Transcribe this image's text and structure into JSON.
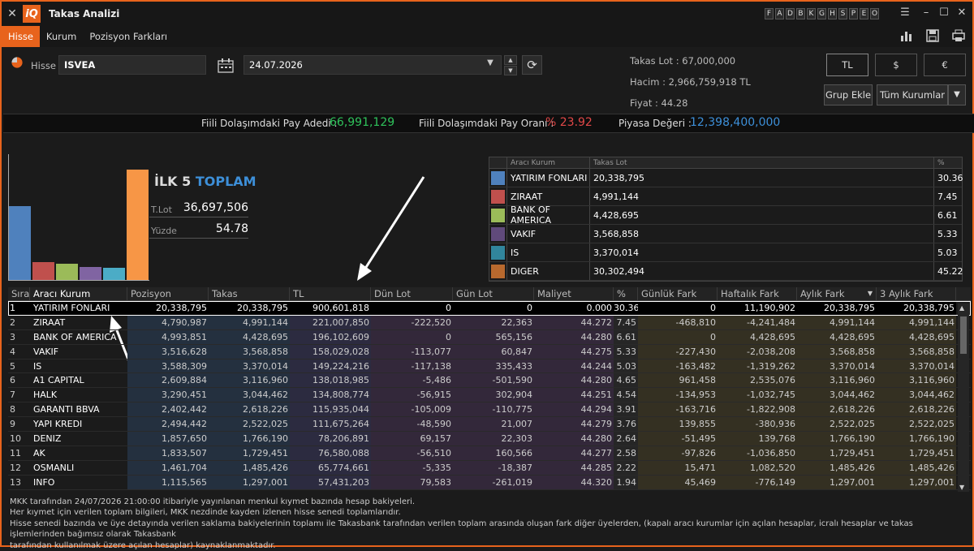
{
  "window": {
    "title": "Takas Analizi",
    "letters": [
      "F",
      "A",
      "D",
      "B",
      "K",
      "G",
      "H",
      "S",
      "P",
      "E",
      "O"
    ]
  },
  "menu": {
    "items": [
      "Hisse",
      "Kurum",
      "Pozisyon Farkları"
    ]
  },
  "form": {
    "hisse_label": "Hisse",
    "hisse_value": "ISVEA",
    "date_value": "24.07.2026",
    "info_takas_lot": "Takas Lot : 67,000,000",
    "info_hacim": "Hacim : 2,966,759,918 TL",
    "info_fiyat": "Fiyat : 44.28",
    "currency": [
      "TL",
      "$",
      "€"
    ],
    "grup_ekle": "Grup Ekle",
    "tum_kurumlar": "Tüm Kurumlar"
  },
  "stats": {
    "pay_adedi_label": "Fiili Dolaşımdaki Pay Adedi :",
    "pay_adedi_value": "66,991,129",
    "pay_orani_label": "Fiili Dolaşımdaki Pay Oranı :",
    "pay_orani_value": "% 23.92",
    "piyasa_label": "Piyasa Değeri :",
    "piyasa_value": "12,398,400,000"
  },
  "summary": {
    "title_a": "İLK 5",
    "title_b": "TOPLAM",
    "tlot_label": "T.Lot",
    "tlot_value": "36,697,506",
    "yuzde_label": "Yüzde",
    "yuzde_value": "54.78"
  },
  "chart_data": {
    "type": "bar",
    "categories": [
      "YATIRIM FONLARI",
      "ZIRAAT",
      "BANK OF AMERICA",
      "VAKIF",
      "IS",
      "DIGER"
    ],
    "values": [
      30.36,
      7.45,
      6.61,
      5.33,
      5.03,
      45.22
    ],
    "colors": [
      "#4f81bd",
      "#c0504d",
      "#9bbb59",
      "#8064a2",
      "#4bacc6",
      "#f79646"
    ],
    "ylim": [
      0,
      50
    ]
  },
  "top_table": {
    "headers": [
      "Aracı Kurum",
      "Takas Lot",
      "%"
    ],
    "rows": [
      {
        "name": "YATIRIM FONLARI",
        "lot": "20,338,795",
        "pct": "30.36",
        "color": "#4f81bd"
      },
      {
        "name": "ZIRAAT",
        "lot": "4,991,144",
        "pct": "7.45",
        "color": "#c0504d"
      },
      {
        "name": "BANK OF AMERICA",
        "lot": "4,428,695",
        "pct": "6.61",
        "color": "#9bbb59"
      },
      {
        "name": "VAKIF",
        "lot": "3,568,858",
        "pct": "5.33",
        "color": "#604a7b"
      },
      {
        "name": "IS",
        "lot": "3,370,014",
        "pct": "5.03",
        "color": "#31859c"
      },
      {
        "name": "DIGER",
        "lot": "30,302,494",
        "pct": "45.22",
        "color": "#b8692e"
      }
    ]
  },
  "grid": {
    "headers": [
      "Sıra",
      "Aracı Kurum",
      "Pozisyon",
      "Takas",
      "TL",
      "Dün Lot",
      "Gün Lot",
      "Maliyet",
      "%",
      "Günlük Fark",
      "Haftalık Fark",
      "Aylık Fark",
      "3 Aylık Fark"
    ],
    "rows": [
      [
        "1",
        "YATIRIM FONLARI",
        "20,338,795",
        "20,338,795",
        "900,601,818",
        "0",
        "0",
        "0.000",
        "30.36",
        "0",
        "11,190,902",
        "20,338,795",
        "20,338,795"
      ],
      [
        "2",
        "ZIRAAT",
        "4,790,987",
        "4,991,144",
        "221,007,850",
        "-222,520",
        "22,363",
        "44.272",
        "7.45",
        "-468,810",
        "-4,241,484",
        "4,991,144",
        "4,991,144"
      ],
      [
        "3",
        "BANK OF AMERICA",
        "4,993,851",
        "4,428,695",
        "196,102,609",
        "0",
        "565,156",
        "44.280",
        "6.61",
        "0",
        "4,428,695",
        "4,428,695",
        "4,428,695"
      ],
      [
        "4",
        "VAKIF",
        "3,516,628",
        "3,568,858",
        "158,029,028",
        "-113,077",
        "60,847",
        "44.275",
        "5.33",
        "-227,430",
        "-2,038,208",
        "3,568,858",
        "3,568,858"
      ],
      [
        "5",
        "IS",
        "3,588,309",
        "3,370,014",
        "149,224,216",
        "-117,138",
        "335,433",
        "44.244",
        "5.03",
        "-163,482",
        "-1,319,262",
        "3,370,014",
        "3,370,014"
      ],
      [
        "6",
        "A1 CAPITAL",
        "2,609,884",
        "3,116,960",
        "138,018,985",
        "-5,486",
        "-501,590",
        "44.280",
        "4.65",
        "961,458",
        "2,535,076",
        "3,116,960",
        "3,116,960"
      ],
      [
        "7",
        "HALK",
        "3,290,451",
        "3,044,462",
        "134,808,774",
        "-56,915",
        "302,904",
        "44.251",
        "4.54",
        "-134,953",
        "-1,032,745",
        "3,044,462",
        "3,044,462"
      ],
      [
        "8",
        "GARANTI BBVA",
        "2,402,442",
        "2,618,226",
        "115,935,044",
        "-105,009",
        "-110,775",
        "44.294",
        "3.91",
        "-163,716",
        "-1,822,908",
        "2,618,226",
        "2,618,226"
      ],
      [
        "9",
        "YAPI KREDI",
        "2,494,442",
        "2,522,025",
        "111,675,264",
        "-48,590",
        "21,007",
        "44.279",
        "3.76",
        "139,855",
        "-380,936",
        "2,522,025",
        "2,522,025"
      ],
      [
        "10",
        "DENIZ",
        "1,857,650",
        "1,766,190",
        "78,206,891",
        "69,157",
        "22,303",
        "44.280",
        "2.64",
        "-51,495",
        "139,768",
        "1,766,190",
        "1,766,190"
      ],
      [
        "11",
        "AK",
        "1,833,507",
        "1,729,451",
        "76,580,088",
        "-56,510",
        "160,566",
        "44.277",
        "2.58",
        "-97,826",
        "-1,036,850",
        "1,729,451",
        "1,729,451"
      ],
      [
        "12",
        "OSMANLI",
        "1,461,704",
        "1,485,426",
        "65,774,661",
        "-5,335",
        "-18,387",
        "44.285",
        "2.22",
        "15,471",
        "1,082,520",
        "1,485,426",
        "1,485,426"
      ],
      [
        "13",
        "INFO",
        "1,115,565",
        "1,297,001",
        "57,431,203",
        "79,583",
        "-261,019",
        "44.320",
        "1.94",
        "45,469",
        "-776,149",
        "1,297,001",
        "1,297,001"
      ]
    ]
  },
  "footer": {
    "l1": "MKK tarafından 24/07/2026 21:00:00 itibariyle yayınlanan menkul kıymet bazında hesap bakiyeleri.",
    "l2": " Her kıymet için verilen toplam bilgileri, MKK nezdinde kayden izlenen hisse senedi toplamlarıdır.",
    "l3": "Hisse senedi bazında ve üye detayında verilen saklama bakiyelerinin toplamı ile Takasbank tarafından verilen toplam arasında oluşan fark diğer üyelerden, (kapalı aracı kurumlar için açılan hesaplar, icralı hesaplar ve takas işlemlerinden bağımsız olarak Takasbank",
    "l4": "tarafından kullanılmak üzere açılan hesaplar) kaynaklanmaktadır."
  }
}
